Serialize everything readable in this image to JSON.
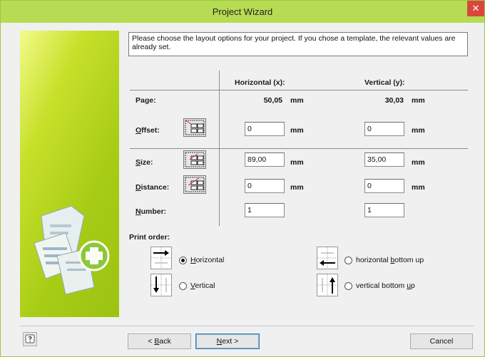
{
  "window": {
    "title": "Project Wizard",
    "close_glyph": "✕"
  },
  "instruction": "Please choose the layout options for your project. If you chose a template, the relevant values are already set.",
  "table": {
    "col_horizontal": "Horizontal (x):",
    "col_vertical": "Vertical (y):",
    "page_label": "Page:",
    "page_x": "50,05",
    "page_y": "30,03",
    "unit": "mm",
    "offset_label": "Offset:",
    "offset_x": "0",
    "offset_y": "0",
    "size_label": "Size:",
    "size_x": "89,00",
    "size_y": "35,00",
    "distance_label": "Distance:",
    "distance_x": "0",
    "distance_y": "0",
    "number_label": "Number:",
    "number_x": "1",
    "number_y": "1"
  },
  "print_order": {
    "label": "Print order:",
    "options": [
      {
        "label": "Horizontal",
        "accel": "H",
        "rest": "orizontal",
        "selected": true
      },
      {
        "label": "Vertical",
        "accel": "V",
        "rest": "ertical",
        "selected": false
      },
      {
        "label": "horizontal bottom up",
        "pre": "horizontal ",
        "accel": "b",
        "rest": "ottom up",
        "selected": false
      },
      {
        "label": "vertical bottom up",
        "pre": "vertical bottom ",
        "accel": "u",
        "rest": "p",
        "selected": false
      }
    ]
  },
  "buttons": {
    "back_accel": "B",
    "back_rest": "ack",
    "back_prefix": "< ",
    "next_accel": "N",
    "next_rest": "ext >",
    "cancel": "Cancel"
  },
  "icons": {
    "help": "help-icon",
    "offset": "offset-layout-icon",
    "size": "size-layout-icon",
    "distance": "distance-layout-icon",
    "side": "project-documents-add-icon"
  },
  "colors": {
    "titlebar": "#b7dc54",
    "close": "#d9473c",
    "side_panel": "#a7cc16"
  }
}
